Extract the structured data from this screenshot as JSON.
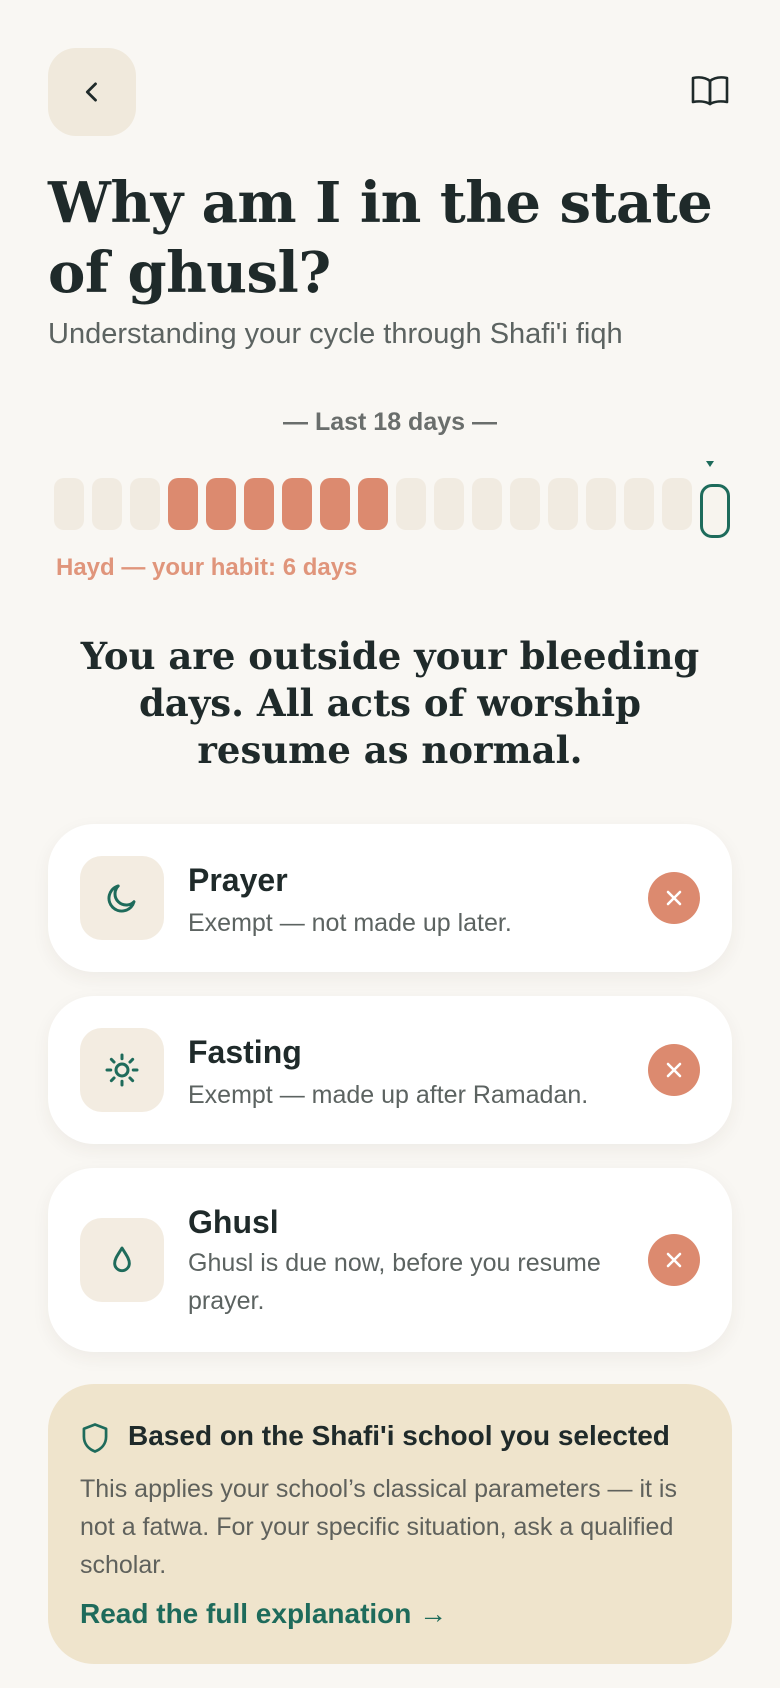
{
  "header": {
    "back_icon": "chevron-left-icon",
    "book_icon": "open-book-icon"
  },
  "title": "Why am I in the state of ghusl?",
  "subtitle": "Understanding your cycle through Shafi'i fiqh",
  "cycle": {
    "period_label": "— Last 18 days —",
    "days": [
      "none",
      "none",
      "none",
      "bleed",
      "bleed",
      "bleed",
      "bleed",
      "bleed",
      "bleed",
      "none",
      "none",
      "none",
      "none",
      "none",
      "none",
      "none",
      "none",
      "today"
    ],
    "habit_note": "Hayd — your habit: 6 days",
    "colors": {
      "bleed": "#dc8a6f",
      "empty": "#f1ebe1",
      "today": "#1e6b5b"
    }
  },
  "status_message": "You are outside your bleeding days. All acts of worship resume as normal.",
  "cards": [
    {
      "icon": "moon-icon",
      "title": "Prayer",
      "description": "Exempt — not made up later.",
      "action_icon": "close-icon"
    },
    {
      "icon": "sun-icon",
      "title": "Fasting",
      "description": "Exempt — made up after Ramadan.",
      "action_icon": "close-icon"
    },
    {
      "icon": "water-drop-icon",
      "title": "Ghusl",
      "description": "Ghusl is due now, before you resume prayer.",
      "action_icon": "close-icon"
    }
  ],
  "info": {
    "icon": "shield-icon",
    "title": "Based on the Shafi'i school you selected",
    "body": "This applies your school’s classical parameters — it is not a fatwa. For your specific situation, ask a qualified scholar.",
    "link": "Read the full explanation →"
  },
  "colors": {
    "accent_green": "#1e6b5b",
    "accent_coral": "#dc8a6f",
    "background": "#f9f7f3",
    "info_background": "#efe4cc"
  }
}
